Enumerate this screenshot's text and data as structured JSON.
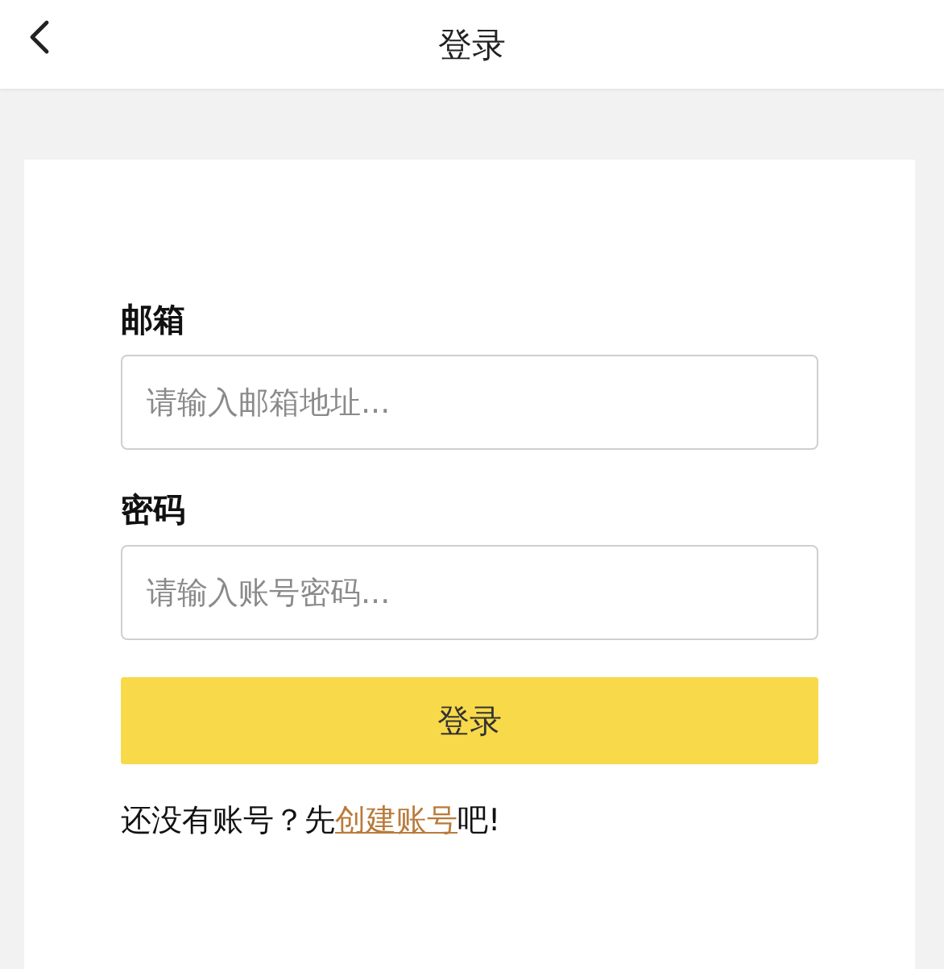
{
  "header": {
    "title": "登录"
  },
  "fields": [
    {
      "label": "邮箱",
      "placeholder": "请输入邮箱地址..."
    },
    {
      "label": "密码",
      "placeholder": "请输入账号密码..."
    }
  ],
  "submit": {
    "label": "登录"
  },
  "signup": {
    "prefix": "还没有账号？先",
    "link": "创建账号",
    "suffix": "吧!"
  }
}
